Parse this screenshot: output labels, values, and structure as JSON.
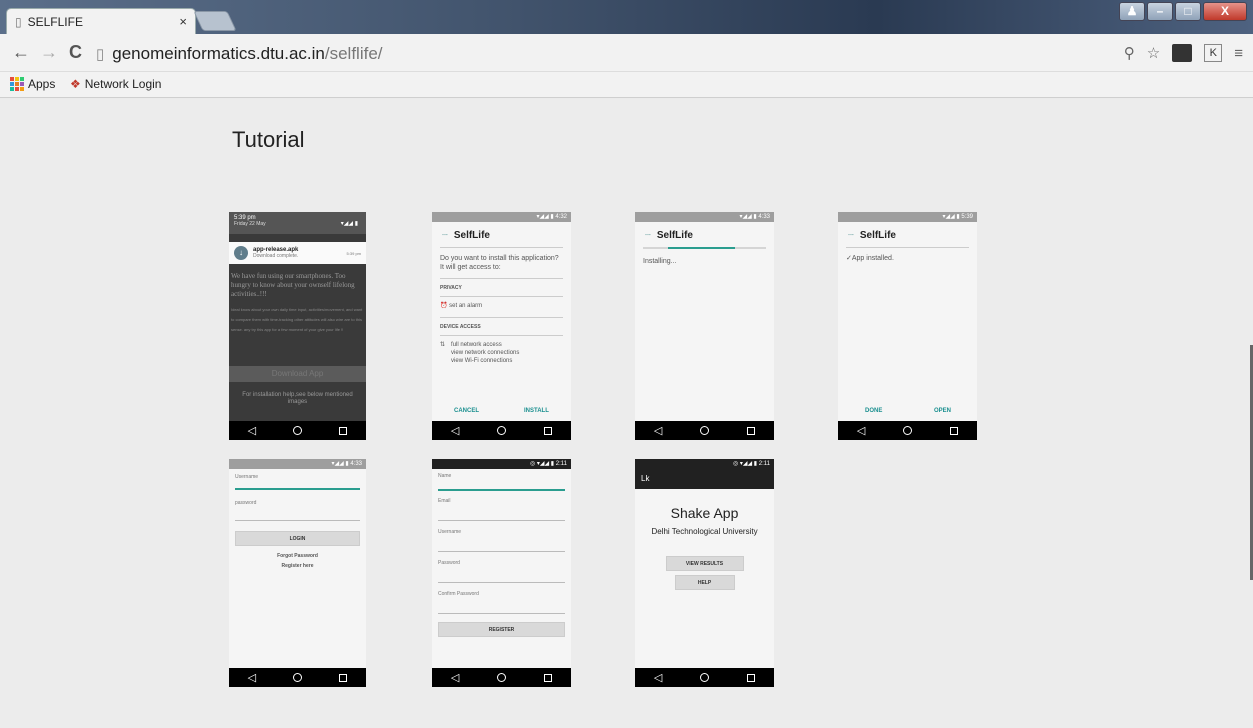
{
  "browser": {
    "tab_title": "SELFLIFE",
    "tab_close": "×",
    "url_host": "genomeinformatics.dtu.ac.in",
    "url_path": "/selflife/",
    "back": "←",
    "forward": "→",
    "reload": "C",
    "window_controls": {
      "profile": "♟",
      "minimize": "–",
      "maximize": "□",
      "close": "X"
    },
    "bookmarks": [
      {
        "label": "Apps"
      },
      {
        "label": "Network Login"
      }
    ],
    "toolbar_k": "K"
  },
  "page": {
    "title": "Tutorial"
  },
  "screens": {
    "notif": {
      "time": "5:39 pm",
      "date": "Friday 22 May",
      "status": "▾◢◢ ▮",
      "app": "app-release.apk",
      "app_sub": "Download complete.",
      "app_time": "5:39 pm",
      "head": "We have fun using our smartphones. Too hungry to know about your ownself lifelong activities..!!!",
      "body": "Ideal know about your own daily time input, activities/movement, and want to compare them with time-tracking other attitudes will also wire are to this sense. any try this app for a few moment of your give your life !!",
      "download": "Download App",
      "install_note": "For installation help,see below mentioned images"
    },
    "install": {
      "status": "▾◢◢ ▮ 4:32",
      "app": "SelfLife",
      "question": "Do you want to install this application? It will get access to:",
      "privacy": "PRIVACY",
      "alarm": "set an alarm",
      "device": "DEVICE ACCESS",
      "perm1": "full network access",
      "perm2": "view network connections",
      "perm3": "view Wi-Fi connections",
      "cancel": "CANCEL",
      "install": "INSTALL"
    },
    "installing": {
      "status": "▾◢◢ ▮ 4:33",
      "app": "SelfLife",
      "text": "Installing..."
    },
    "installed": {
      "status": "▾◢◢ ▮ 5:39",
      "app": "SelfLife",
      "text": "✓App installed.",
      "done": "DONE",
      "open": "OPEN"
    },
    "login": {
      "status": "▾◢◢ ▮ 4:33",
      "username": "Username",
      "password": "password",
      "login": "LOGIN",
      "forgot": "Forgot Password",
      "register": "Register here"
    },
    "register": {
      "status": "◎ ▾◢◢ ▮ 2:11",
      "name": "Name",
      "email": "Email",
      "username": "Username",
      "password": "Password",
      "confirm": "Confirm Password",
      "button": "REGISTER"
    },
    "shake": {
      "status": "◎ ▾◢◢ ▮ 2:11",
      "bar": "Lk",
      "title": "Shake App",
      "subtitle": "Delhi Technological University",
      "results": "VIEW RESULTS",
      "help": "HELP"
    }
  },
  "navbar": {
    "back": "◁"
  }
}
